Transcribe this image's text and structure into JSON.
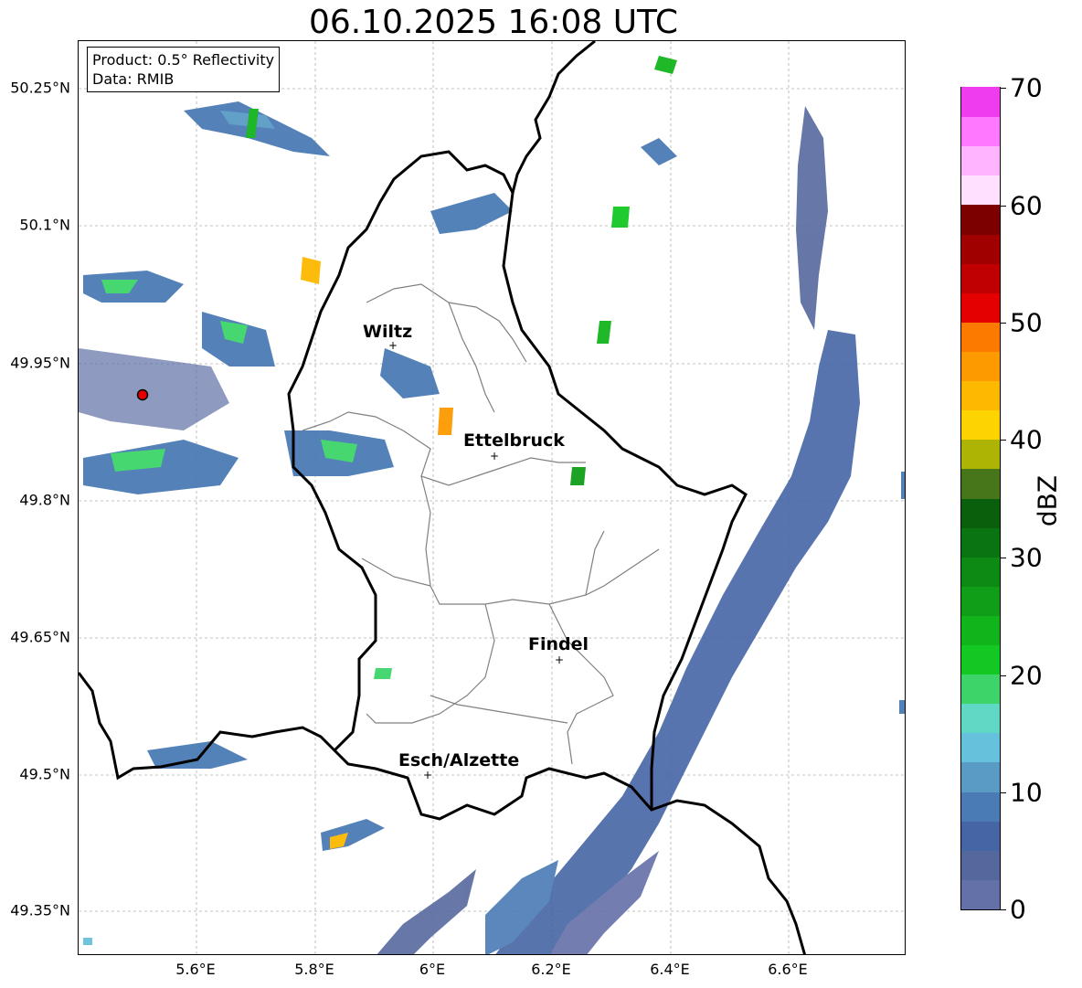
{
  "title": "06.10.2025 16:08 UTC",
  "info_box": {
    "product": "Product: 0.5° Reflectivity",
    "data": "Data: RMIB"
  },
  "lat_labels": [
    "50.25°N",
    "50.1°N",
    "49.95°N",
    "49.8°N",
    "49.65°N",
    "49.5°N",
    "49.35°N"
  ],
  "lon_labels": [
    "5.6°E",
    "5.8°E",
    "6°E",
    "6.2°E",
    "6.4°E",
    "6.6°E"
  ],
  "cities": [
    {
      "name": "Wiltz"
    },
    {
      "name": "Ettelbruck"
    },
    {
      "name": "Findel"
    },
    {
      "name": "Esch/Alzette"
    }
  ],
  "colorbar": {
    "label": "dBZ",
    "ticks": [
      "70",
      "60",
      "50",
      "40",
      "30",
      "20",
      "10",
      "0"
    ],
    "colors": [
      "#6470a8",
      "#55689e",
      "#4565a5",
      "#4a7bb5",
      "#5a9bc6",
      "#66c1dc",
      "#5fd8c6",
      "#3dd56a",
      "#14c823",
      "#12b41c",
      "#109e18",
      "#0d8a14",
      "#0a7510",
      "#095f0c",
      "#47761a",
      "#adb403",
      "#fed400",
      "#fdb900",
      "#fd9a00",
      "#fd7a00",
      "#e40000",
      "#c00000",
      "#a00000",
      "#7c0000",
      "#ffe0ff",
      "#ffb4ff",
      "#ff78ff",
      "#ee3cee"
    ]
  }
}
